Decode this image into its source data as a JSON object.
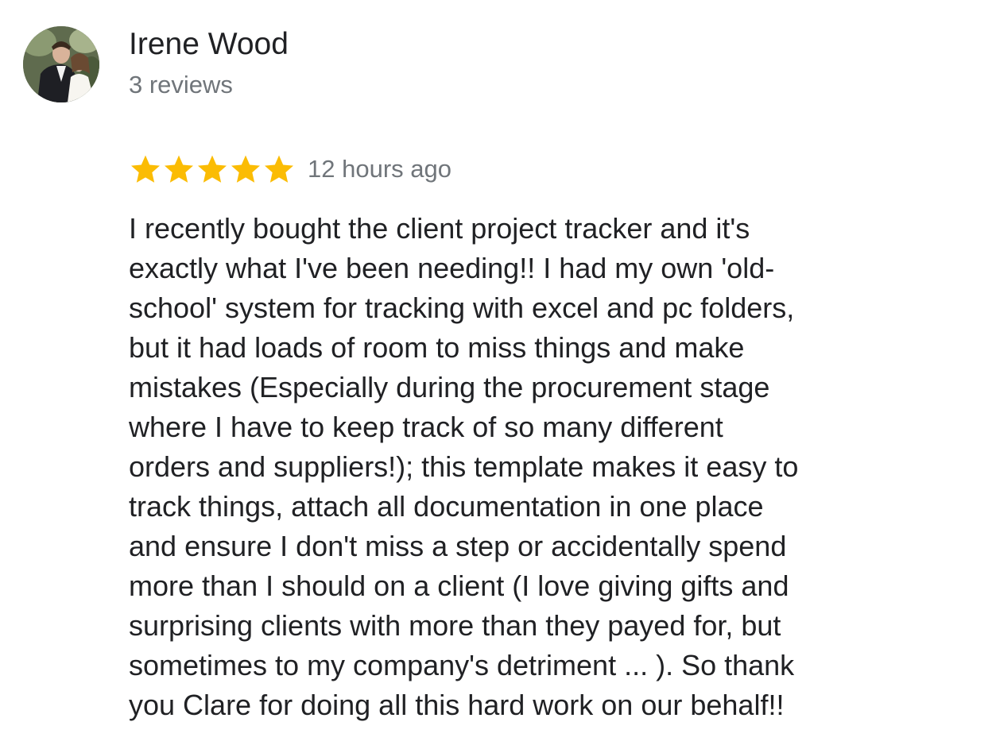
{
  "reviewer": {
    "name": "Irene Wood",
    "review_count": "3 reviews"
  },
  "review": {
    "rating": 5,
    "rating_max": 5,
    "star_color": "#fbbc04",
    "timestamp": "12 hours ago",
    "lines": [
      "I recently bought the client project tracker and it's",
      "exactly what I've been needing!! I had my own 'old-",
      "school' system for tracking with excel and pc folders,",
      "but it had loads of room to miss things and make",
      "mistakes (Especially during the procurement stage",
      "where I have to keep track of so many different",
      "orders and suppliers!); this template makes it easy to",
      "track things, attach all documentation in one place",
      "and ensure I don't miss a step or accidentally spend",
      "more than I should on a client (I love giving gifts and",
      "surprising clients with more than they payed for, but",
      "sometimes to my company's detriment ... ). So thank",
      "you Clare for doing all this hard work on our behalf!!"
    ]
  }
}
